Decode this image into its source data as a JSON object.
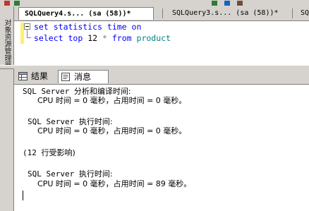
{
  "editor_tabs": [
    {
      "label": "SQLQuery4.s...    (sa (58))*",
      "active": true
    },
    {
      "label": "SQLQuery3.s...    (sa (58))*",
      "active": false
    },
    {
      "label": "SQ",
      "active": false
    }
  ],
  "sidebar": {
    "label": "对象资源管理器"
  },
  "query": {
    "line1": {
      "kw1": "set",
      "kw2": "statistics",
      "kw3": "time",
      "kw4": "on"
    },
    "line2": {
      "kw1": "select",
      "kw2": "top",
      "num": "12",
      "star": "*",
      "kw3": "from",
      "table": "product"
    }
  },
  "result_tabs": {
    "results": "结果",
    "messages": "消息"
  },
  "messages": {
    "b1_header_prefix": "SQL Server ",
    "b1_header_cn": "分析和编译时间:",
    "b1_line": "CPU 时间 = 0 毫秒，占用时间 = 0 毫秒。",
    "b2_header_prefix": "SQL Server ",
    "b2_header_cn": "执行时间:",
    "b2_line": "CPU 时间 = 0 毫秒，占用时间 = 0 毫秒。",
    "rows_prefix": "(12 ",
    "rows_cn": "行受影响)",
    "b3_header_prefix": "SQL Server ",
    "b3_header_cn": "执行时间:",
    "b3_line": "CPU 时间 = 0 毫秒，占用时间 = 89 毫秒。"
  },
  "colors": {
    "keyword": "#0000ff",
    "identifier": "#008080",
    "operator": "#808080",
    "chrome": "#d6d3ce",
    "change_marker": "#ffef6e"
  }
}
